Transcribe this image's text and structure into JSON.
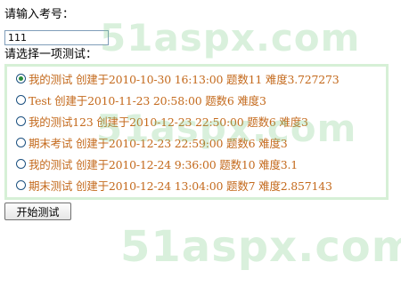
{
  "form": {
    "exam_number_label": "请输入考号：",
    "exam_number_value": "111",
    "choose_test_label": "请选择一项测试：",
    "start_button_label": "开始测试"
  },
  "tests": [
    {
      "text": "我的测试 创建于2010-10-30 16:13:00 题数11 难度3.727273",
      "selected": true
    },
    {
      "text": "Test 创建于2010-11-23 20:58:00 题数6 难度3",
      "selected": false
    },
    {
      "text": "我的测试123 创建于2010-12-23 22:50:00 题数6 难度3",
      "selected": false
    },
    {
      "text": "期末考试 创建于2010-12-23 22:59:00 题数6 难度3",
      "selected": false
    },
    {
      "text": "我的测试 创建于2010-12-24 9:36:00 题数10 难度3.1",
      "selected": false
    },
    {
      "text": "期末测试 创建于2010-12-24 13:04:00 题数7 难度2.857143",
      "selected": false
    }
  ],
  "watermark": {
    "text": "51aspx.com"
  },
  "colors": {
    "option_text": "#c46a1d",
    "list_border": "#d6f0d6",
    "watermark": "#78c882"
  }
}
